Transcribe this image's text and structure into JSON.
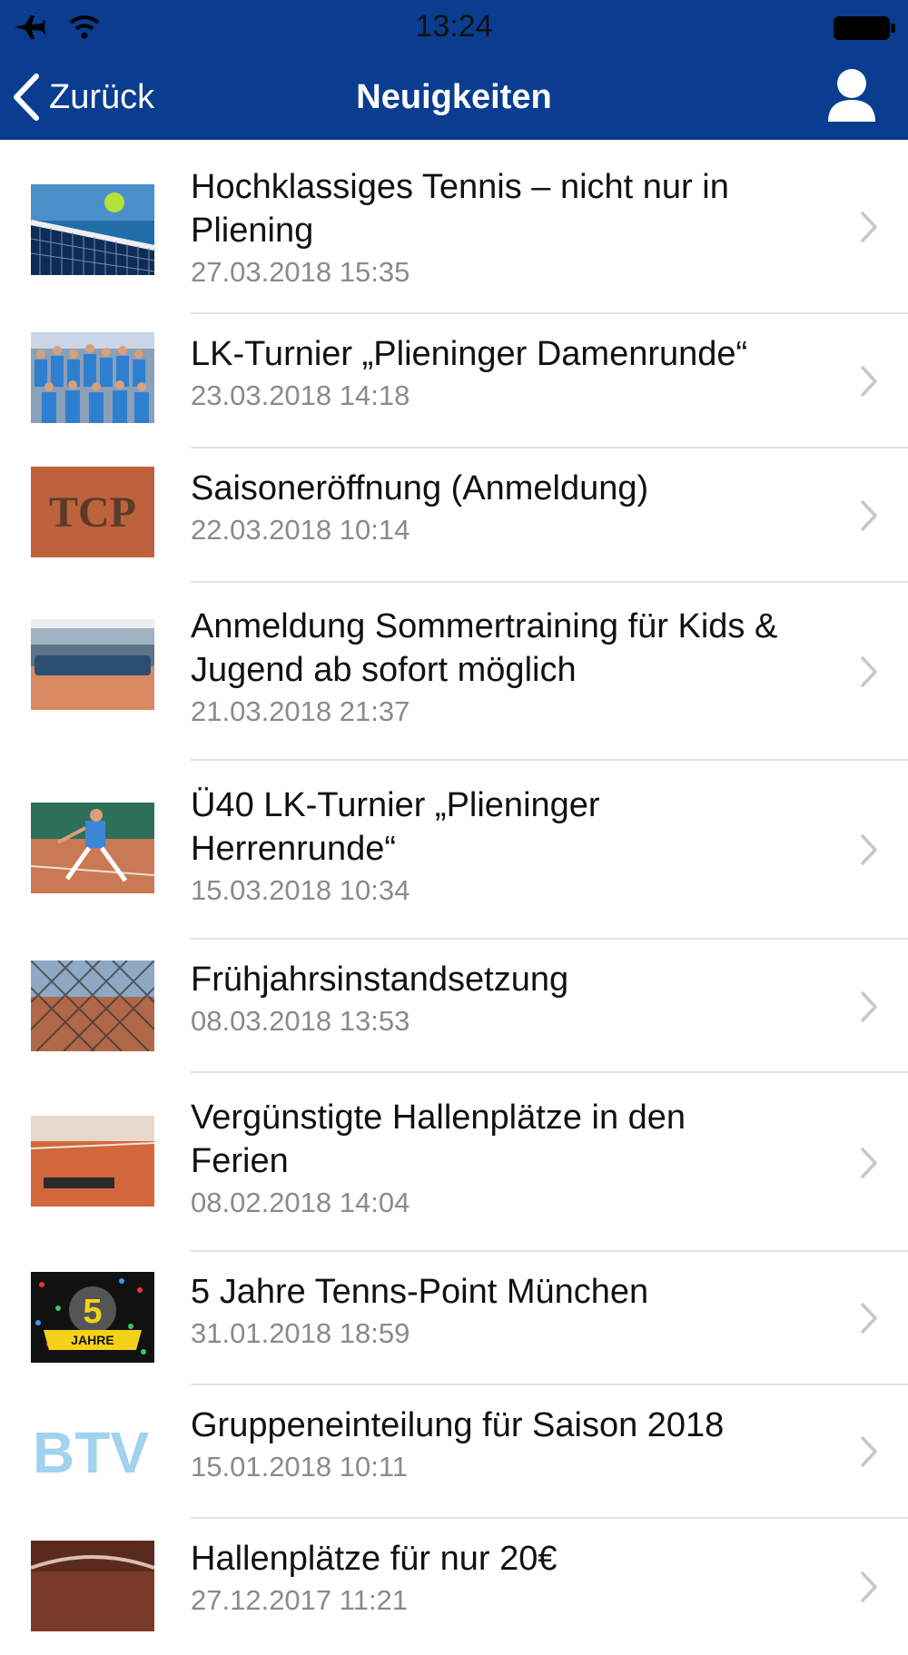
{
  "status_bar": {
    "time": "13:24"
  },
  "nav": {
    "back_label": "Zurück",
    "title": "Neuigkeiten"
  },
  "news": [
    {
      "title_line1": "Hochklassiges Tennis – nicht nur in",
      "title_line2": "Pliening",
      "date": "27.03.2018 15:35"
    },
    {
      "title_line1": "LK-Turnier „Plieninger Damenrunde“",
      "title_line2": "",
      "date": "23.03.2018 14:18"
    },
    {
      "title_line1": "Saisoneröffnung (Anmeldung)",
      "title_line2": "",
      "date": "22.03.2018 10:14"
    },
    {
      "title_line1": "Anmeldung Sommertraining für Kids &",
      "title_line2": "Jugend ab sofort möglich",
      "date": "21.03.2018 21:37"
    },
    {
      "title_line1": "Ü40 LK-Turnier „Plieninger",
      "title_line2": "Herrenrunde“",
      "date": "15.03.2018 10:34"
    },
    {
      "title_line1": "Frühjahrsinstandsetzung",
      "title_line2": "",
      "date": "08.03.2018 13:53"
    },
    {
      "title_line1": "Vergünstigte Hallenplätze in den",
      "title_line2": "Ferien",
      "date": "08.02.2018 14:04"
    },
    {
      "title_line1": "5 Jahre Tenns-Point München",
      "title_line2": "",
      "date": "31.01.2018 18:59"
    },
    {
      "title_line1": "Gruppeneinteilung für Saison 2018",
      "title_line2": "",
      "date": "15.01.2018 10:11"
    },
    {
      "title_line1": "Hallenplätze für nur 20€",
      "title_line2": "",
      "date": "27.12.2017 11:21"
    }
  ],
  "thumb_texts": {
    "five_years": "5",
    "jahre": "JAHRE",
    "tcp": "TCP",
    "btv": "BTV"
  },
  "colors": {
    "nav_bg": "#0a3d8f",
    "separator": "#e2e2e2",
    "date": "#8a8a8a",
    "chevron": "#c7c7cc"
  }
}
